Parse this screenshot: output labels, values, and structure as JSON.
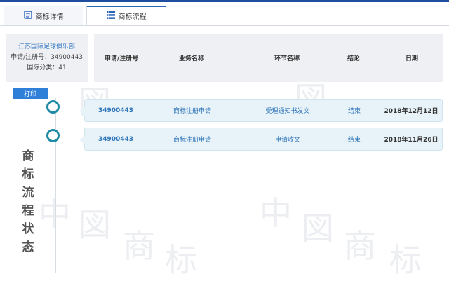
{
  "tabs": [
    {
      "label": "商标详情",
      "icon": "document-icon"
    },
    {
      "label": "商标流程",
      "icon": "list-icon"
    }
  ],
  "info": {
    "name": "江苏国际足球俱乐部",
    "reg_no_line": "申请/注册号：34900443",
    "class_line": "国际分类：41"
  },
  "table_headers": [
    "申请/注册号",
    "业务名称",
    "环节名称",
    "结论",
    "日期"
  ],
  "print_label": "打印",
  "timeline_title": [
    "商",
    "标",
    "流",
    "程",
    "状",
    "态"
  ],
  "rows": [
    {
      "reg_no": "34900443",
      "business": "商标注册申请",
      "stage": "受理通知书发文",
      "result": "结束",
      "date": "2018年12月12日"
    },
    {
      "reg_no": "34900443",
      "business": "商标注册申请",
      "stage": "申请收文",
      "result": "结束",
      "date": "2018年11月26日"
    }
  ],
  "colors": {
    "accent": "#2f7fd8",
    "node": "#1e8aa6",
    "row_bg": "#e8f3f9",
    "header_bg": "#eef0f3"
  }
}
